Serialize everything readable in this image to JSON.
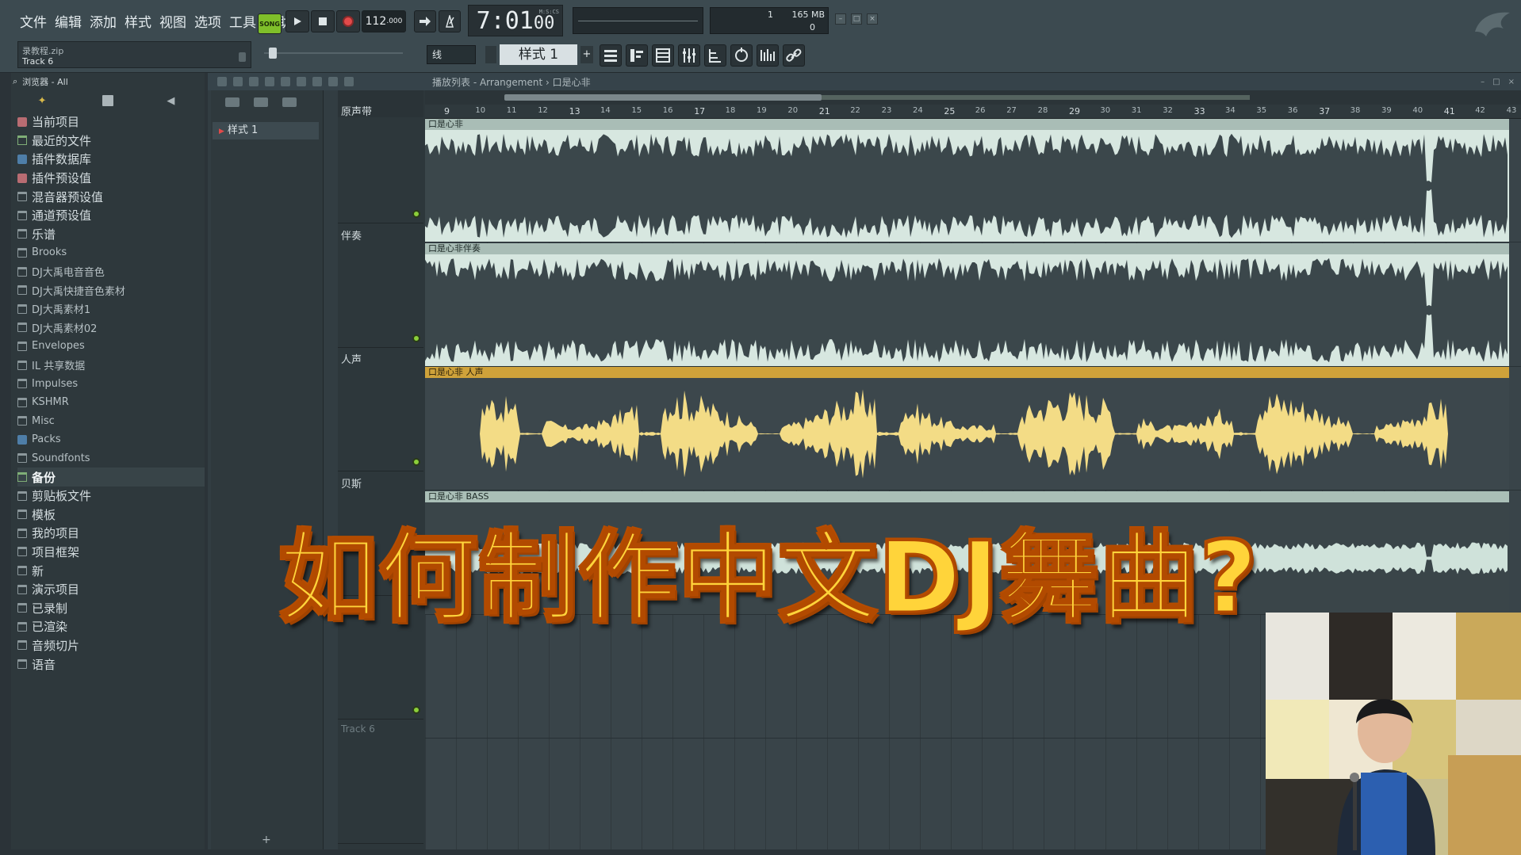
{
  "menu": [
    "文件",
    "编辑",
    "添加",
    "样式",
    "视图",
    "选项",
    "工具",
    "帮助"
  ],
  "hint": {
    "line1": "录教程.zip",
    "line2": "Track 6"
  },
  "transport": {
    "song_mode": "SONG",
    "tempo": "112",
    "tempo_decimal": ".000",
    "time": "7:01",
    "time_sub": "00",
    "time_unit": "M:S:CS"
  },
  "cpu": {
    "value1": "1",
    "memory": "165 MB",
    "value2": "0"
  },
  "pitch_mode": "线",
  "pattern": {
    "name": "样式 1",
    "add": "+"
  },
  "browser": {
    "head": "浏览器 - All",
    "items": [
      {
        "label": "当前项目",
        "icon": "pink"
      },
      {
        "label": "最近的文件",
        "icon": "green"
      },
      {
        "label": "插件数据库",
        "icon": "blue"
      },
      {
        "label": "插件预设值",
        "icon": "pink"
      },
      {
        "label": "混音器预设值",
        "icon": "folder"
      },
      {
        "label": "通道预设值",
        "icon": "folder"
      },
      {
        "label": "乐谱",
        "icon": "folder"
      },
      {
        "label": "Brooks",
        "icon": "folder",
        "small": true
      },
      {
        "label": "DJ大禹电音音色",
        "icon": "folder",
        "small": true
      },
      {
        "label": "DJ大禹快捷音色素材",
        "icon": "folder",
        "small": true
      },
      {
        "label": "DJ大禹素材1",
        "icon": "folder",
        "small": true
      },
      {
        "label": "DJ大禹素材02",
        "icon": "folder",
        "small": true
      },
      {
        "label": "Envelopes",
        "icon": "folder",
        "small": true
      },
      {
        "label": "IL 共享数据",
        "icon": "folder",
        "small": true
      },
      {
        "label": "Impulses",
        "icon": "folder",
        "small": true
      },
      {
        "label": "KSHMR",
        "icon": "folder",
        "small": true
      },
      {
        "label": "Misc",
        "icon": "folder",
        "small": true
      },
      {
        "label": "Packs",
        "icon": "blue",
        "small": true
      },
      {
        "label": "Soundfonts",
        "icon": "folder",
        "small": true
      },
      {
        "label": "备份",
        "icon": "green",
        "selected": true
      },
      {
        "label": "剪贴板文件",
        "icon": "folder"
      },
      {
        "label": "模板",
        "icon": "folder"
      },
      {
        "label": "我的项目",
        "icon": "folder"
      },
      {
        "label": "项目框架",
        "icon": "folder"
      },
      {
        "label": "新",
        "icon": "folder"
      },
      {
        "label": "演示项目",
        "icon": "folder"
      },
      {
        "label": "已录制",
        "icon": "folder"
      },
      {
        "label": "已渲染",
        "icon": "folder"
      },
      {
        "label": "音频切片",
        "icon": "folder"
      },
      {
        "label": "语音",
        "icon": "folder"
      }
    ]
  },
  "playlist": {
    "title": "播放列表 - Arrangement › 口是心非",
    "pattern_item": "样式 1",
    "pattern_add": "+",
    "ruler": [
      "9",
      "10",
      "11",
      "12",
      "13",
      "14",
      "15",
      "16",
      "17",
      "18",
      "19",
      "20",
      "21",
      "22",
      "23",
      "24",
      "25",
      "26",
      "27",
      "28",
      "29",
      "30",
      "31",
      "32",
      "33",
      "34",
      "35",
      "36",
      "37",
      "38",
      "39",
      "40",
      "41",
      "42",
      "43"
    ],
    "tracks": [
      {
        "name": "原声带",
        "clip": "口是心非"
      },
      {
        "name": "伴奏",
        "clip": "口是心非伴奏"
      },
      {
        "name": "人声",
        "clip": "口是心非 人声"
      },
      {
        "name": "贝斯",
        "clip": "口是心非 BASS"
      },
      {
        "name": "",
        "clip": ""
      },
      {
        "name": "Track 6",
        "clip": ""
      }
    ]
  },
  "overlay_title": "如何制作中文DJ舞曲?",
  "colors": {
    "accent_green": "#8bcf3a",
    "vocal_clip": "#cfa23a",
    "waveform": "#dff2e9",
    "title_yellow": "#ffd43a"
  }
}
